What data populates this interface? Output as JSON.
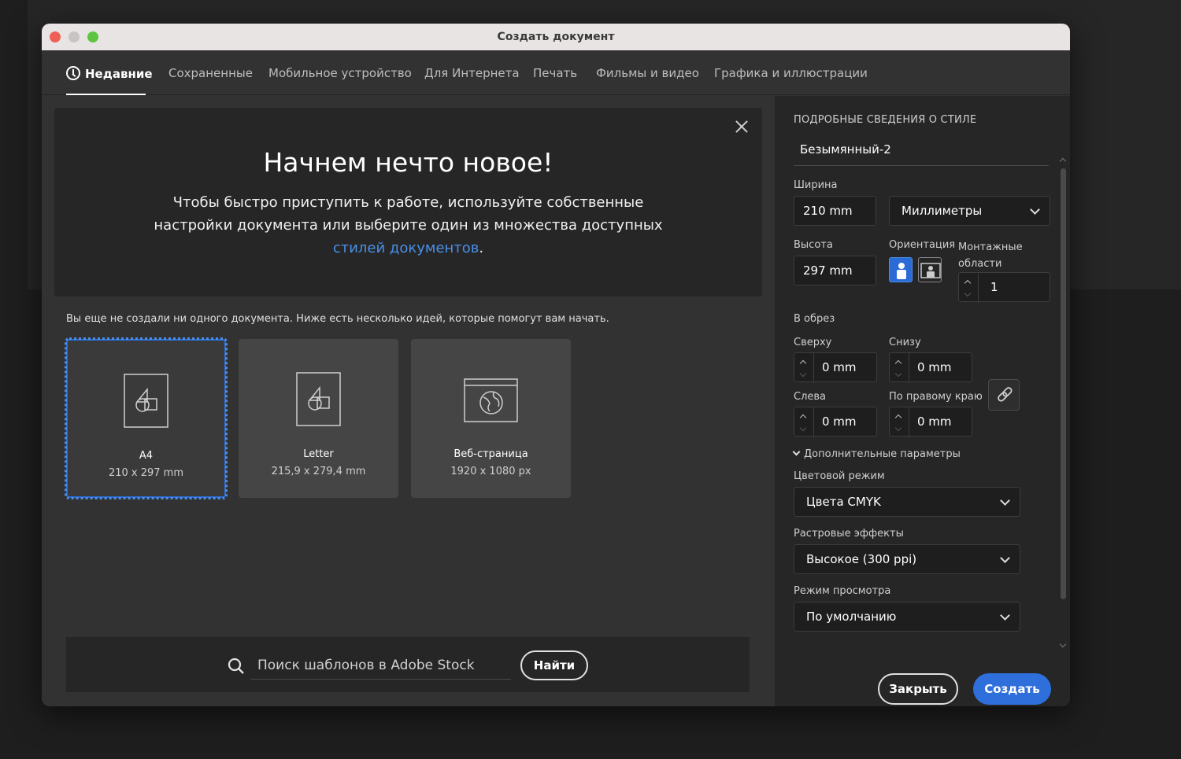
{
  "window": {
    "title": "Создать документ"
  },
  "tabs": [
    {
      "label": "Недавние",
      "active": true
    },
    {
      "label": "Сохраненные"
    },
    {
      "label": "Мобильное устройство"
    },
    {
      "label": "Для Интернета"
    },
    {
      "label": "Печать"
    },
    {
      "label": "Фильмы и видео"
    },
    {
      "label": "Графика и иллюстрации"
    }
  ],
  "welcome": {
    "heading": "Начнем нечто новое!",
    "body_text": "Чтобы быстро приступить к работе, используйте собственные настройки документа или выберите один из множества доступных",
    "link_text": "стилей документов",
    "body_end": "."
  },
  "recent": {
    "hint": "Вы еще не создали ни одного документа. Ниже есть несколько идей, которые помогут вам начать.",
    "presets": [
      {
        "name": "A4",
        "size": "210 x 297 mm",
        "icon": "document-shapes-icon",
        "selected": true
      },
      {
        "name": "Letter",
        "size": "215,9 x 279,4 mm",
        "icon": "document-shapes-icon"
      },
      {
        "name": "Веб-страница",
        "size": "1920 x 1080 px",
        "icon": "web-globe-icon"
      }
    ]
  },
  "search": {
    "placeholder": "Поиск шаблонов в Adobe Stock",
    "button": "Найти"
  },
  "details": {
    "section_title": "ПОДРОБНЫЕ СВЕДЕНИЯ О СТИЛЕ",
    "doc_name": "Безымянный-2",
    "width_label": "Ширина",
    "width_value": "210 mm",
    "units": "Миллиметры",
    "height_label": "Высота",
    "height_value": "297 mm",
    "orientation_label": "Ориентация",
    "artboards_label": "Монтажные области",
    "artboards_value": "1",
    "bleed_label": "В обрез",
    "bleed_top_label": "Сверху",
    "bleed_top": "0 mm",
    "bleed_bottom_label": "Снизу",
    "bleed_bottom": "0 mm",
    "bleed_left_label": "Слева",
    "bleed_left": "0 mm",
    "bleed_right_label": "По правому краю",
    "bleed_right": "0 mm",
    "advanced_label": "Дополнительные параметры",
    "color_mode_label": "Цветовой режим",
    "color_mode": "Цвета CMYK",
    "raster_label": "Растровые эффекты",
    "raster": "Высокое (300 ppi)",
    "preview_label": "Режим просмотра",
    "preview": "По умолчанию"
  },
  "actions": {
    "close": "Закрыть",
    "create": "Создать"
  },
  "colors": {
    "accent": "#2f6fdc",
    "link": "#4a8fe8",
    "panel": "#262626",
    "window": "#323232"
  }
}
